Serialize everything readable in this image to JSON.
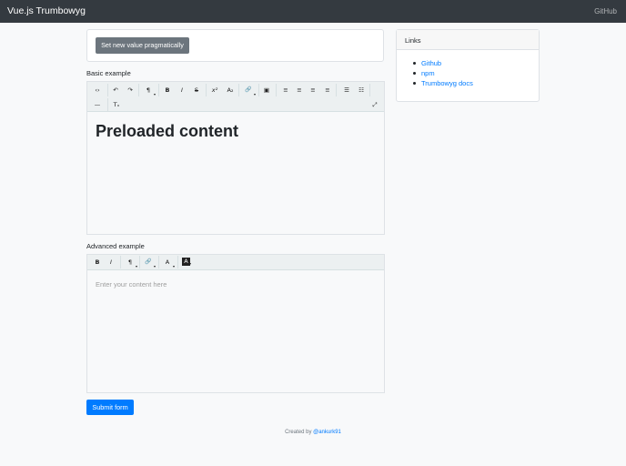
{
  "navbar": {
    "brand": "Vue.js Trumbowyg",
    "github_link": "GitHub"
  },
  "actions": {
    "set_value_label": "Set new value pragmatically"
  },
  "basic": {
    "label": "Basic example",
    "content_heading": "Preloaded content",
    "toolbar": [
      {
        "name": "view-html-icon",
        "glyph": "‹›"
      },
      {
        "name": "undo-icon",
        "glyph": "↶"
      },
      {
        "name": "redo-icon",
        "glyph": "↷"
      },
      {
        "name": "formatting-icon",
        "glyph": "¶"
      },
      {
        "name": "bold-icon",
        "glyph": "B"
      },
      {
        "name": "italic-icon",
        "glyph": "I"
      },
      {
        "name": "strikethrough-icon",
        "glyph": "S"
      },
      {
        "name": "superscript-icon",
        "glyph": "x²"
      },
      {
        "name": "subscript-icon",
        "glyph": "A₂"
      },
      {
        "name": "link-icon",
        "glyph": "🔗"
      },
      {
        "name": "image-icon",
        "glyph": "▣"
      },
      {
        "name": "justify-left-icon",
        "glyph": "≡"
      },
      {
        "name": "justify-center-icon",
        "glyph": "≡"
      },
      {
        "name": "justify-right-icon",
        "glyph": "≡"
      },
      {
        "name": "justify-full-icon",
        "glyph": "≡"
      },
      {
        "name": "unordered-list-icon",
        "glyph": "☰"
      },
      {
        "name": "ordered-list-icon",
        "glyph": "☷"
      },
      {
        "name": "fullscreen-icon",
        "glyph": "⤢"
      },
      {
        "name": "horizontal-rule-icon",
        "glyph": "—"
      },
      {
        "name": "remove-format-icon",
        "glyph": "Tₓ"
      }
    ]
  },
  "advanced": {
    "label": "Advanced example",
    "placeholder": "Enter your content here",
    "toolbar": [
      {
        "name": "bold-icon",
        "glyph": "B"
      },
      {
        "name": "italic-icon",
        "glyph": "I"
      },
      {
        "name": "formatting-icon",
        "glyph": "¶"
      },
      {
        "name": "link-icon",
        "glyph": "🔗"
      },
      {
        "name": "font-color-icon",
        "glyph": "A"
      },
      {
        "name": "background-color-icon",
        "glyph": "A"
      }
    ]
  },
  "links": {
    "title": "Links",
    "items": [
      "Github",
      "npm",
      "Trumbowyg docs"
    ]
  },
  "form": {
    "submit_label": "Submit form"
  },
  "footer": {
    "prefix": "Created by ",
    "author": "@ankurk91"
  },
  "colors": {
    "navbar": "#343a40",
    "primary": "#007bff",
    "secondary": "#6c757d",
    "toolbar": "#ecf0f1"
  }
}
